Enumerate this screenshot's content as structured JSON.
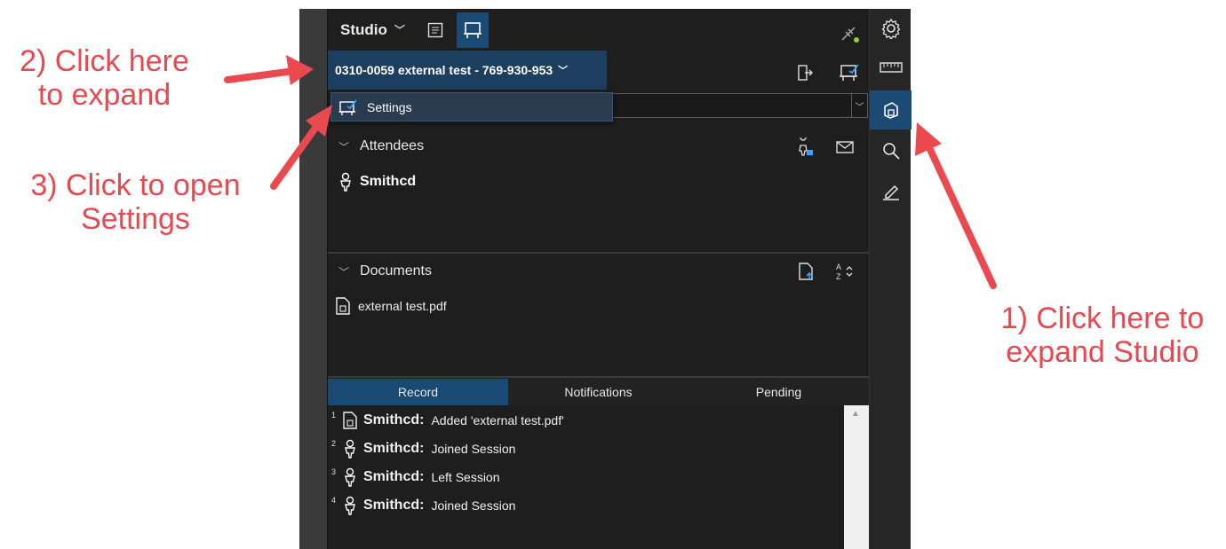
{
  "annotations": {
    "step2": "2) Click here\nto expand",
    "step3": "3) Click to open\nSettings",
    "step1": "1) Click here to\nexpand Studio"
  },
  "studio": {
    "title": "Studio",
    "session_label": "0310-0059 external test - 769-930-953",
    "menu_settings": "Settings"
  },
  "attendees": {
    "heading": "Attendees",
    "items": [
      {
        "name": "Smithcd"
      }
    ]
  },
  "documents": {
    "heading": "Documents",
    "items": [
      {
        "name": "external test.pdf"
      }
    ]
  },
  "tabs": [
    {
      "label": "Record",
      "active": true
    },
    {
      "label": "Notifications",
      "active": false
    },
    {
      "label": "Pending",
      "active": false
    }
  ],
  "record": [
    {
      "num": "1",
      "who": "Smithcd:",
      "text": "Added 'external test.pdf'",
      "icon": "document-icon"
    },
    {
      "num": "2",
      "who": "Smithcd:",
      "text": "Joined Session",
      "icon": "person-icon"
    },
    {
      "num": "3",
      "who": "Smithcd:",
      "text": "Left Session",
      "icon": "person-icon"
    },
    {
      "num": "4",
      "who": "Smithcd:",
      "text": "Joined Session",
      "icon": "person-icon"
    }
  ],
  "colors": {
    "annotation": "#e8484f",
    "accent": "#1b4a74"
  }
}
